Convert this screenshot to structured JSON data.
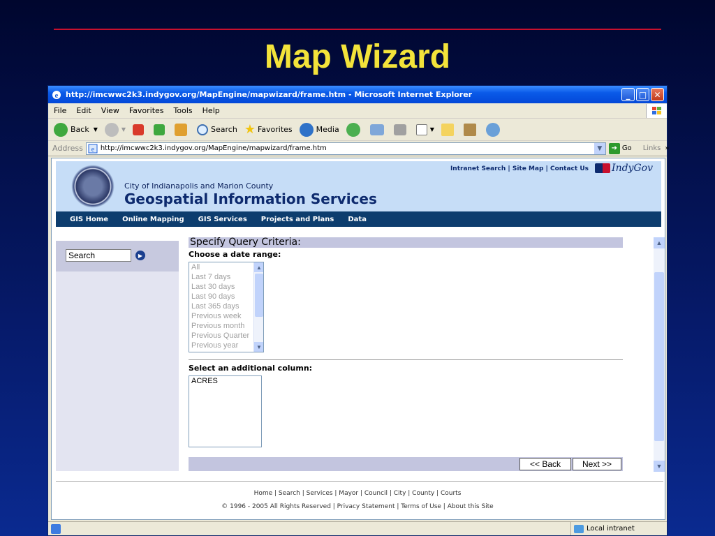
{
  "slide": {
    "title": "Map Wizard"
  },
  "window": {
    "title": "http://imcwwc2k3.indygov.org/MapEngine/mapwizard/frame.htm - Microsoft Internet Explorer",
    "buttons": {
      "minimize": "_",
      "maximize": "□",
      "close": "✕"
    }
  },
  "menu": [
    "File",
    "Edit",
    "View",
    "Favorites",
    "Tools",
    "Help"
  ],
  "toolbar": {
    "back": "Back",
    "search": "Search",
    "favorites": "Favorites",
    "media": "Media"
  },
  "address": {
    "label": "Address",
    "url": "http://imcwwc2k3.indygov.org/MapEngine/mapwizard/frame.htm",
    "go": "Go",
    "links": "Links"
  },
  "page": {
    "banner": {
      "org": "City of Indianapolis and Marion County",
      "title": "Geospatial Information Services",
      "toplinks": "Intranet Search | Site Map | Contact Us",
      "brand": "IndyGov"
    },
    "nav": [
      "GIS Home",
      "Online Mapping",
      "GIS Services",
      "Projects and Plans",
      "Data"
    ],
    "sidebar_search": "Search",
    "form": {
      "header": "Specify Query Criteria:",
      "date_label": "Choose a date range:",
      "date_options": [
        "All",
        "Last 7 days",
        "Last 30 days",
        "Last 90 days",
        "Last 365 days",
        "Previous week",
        "Previous month",
        "Previous Quarter",
        "Previous year"
      ],
      "column_label": "Select an additional column:",
      "column_options": [
        "ACRES"
      ],
      "back_button": "<< Back",
      "next_button": "Next >>"
    },
    "footer": {
      "links": "Home | Search | Services | Mayor | Council | City | County | Courts",
      "copyright": "© 1996 - 2005 All Rights Reserved | Privacy Statement | Terms of Use | About this Site"
    }
  },
  "statusbar": {
    "zone": "Local intranet"
  }
}
